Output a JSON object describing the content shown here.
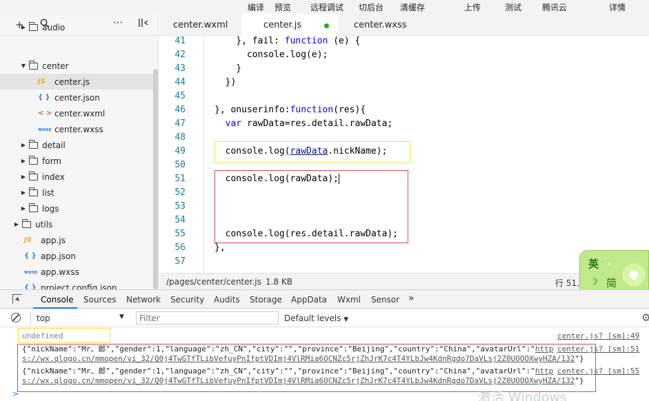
{
  "toolbar": {
    "items": [
      "编译",
      "预览",
      "远程调试",
      "切后台",
      "清缓存",
      "上传",
      "测试",
      "腾讯云",
      "详情"
    ]
  },
  "sidebar": {
    "tree": [
      {
        "label": "audio",
        "kind": "folder",
        "expanded": false
      },
      {
        "label": "center",
        "kind": "folder",
        "expanded": true
      },
      {
        "label": "center.js",
        "kind": "file",
        "icon": "JS",
        "selected": true
      },
      {
        "label": "center.json",
        "kind": "file",
        "icon": "{ }"
      },
      {
        "label": "center.wxml",
        "kind": "file",
        "icon": "< >"
      },
      {
        "label": "center.wxss",
        "kind": "file",
        "icon": "wxss"
      },
      {
        "label": "detail",
        "kind": "folder",
        "expanded": false
      },
      {
        "label": "form",
        "kind": "folder",
        "expanded": false
      },
      {
        "label": "index",
        "kind": "folder",
        "expanded": false
      },
      {
        "label": "list",
        "kind": "folder",
        "expanded": false
      },
      {
        "label": "logs",
        "kind": "folder",
        "expanded": false
      },
      {
        "label": "utils",
        "kind": "folder",
        "expanded": false
      },
      {
        "label": "app.js",
        "kind": "file",
        "icon": "JS"
      },
      {
        "label": "app.json",
        "kind": "file",
        "icon": "{ }"
      },
      {
        "label": "app.wxss",
        "kind": "file",
        "icon": "wxss"
      },
      {
        "label": "project.config.json",
        "kind": "file",
        "icon": "{ }"
      }
    ]
  },
  "tabs": [
    {
      "label": "center.wxml",
      "active": false
    },
    {
      "label": "center.js",
      "active": true,
      "modified": true
    },
    {
      "label": "center.wxss",
      "active": false
    }
  ],
  "editor": {
    "lines": [
      {
        "n": "41",
        "t": "    }, fail: function (e) {"
      },
      {
        "n": "42",
        "t": "      console.log(e);"
      },
      {
        "n": "43",
        "t": "    }"
      },
      {
        "n": "44",
        "t": "  })"
      },
      {
        "n": "45",
        "t": ""
      },
      {
        "n": "46",
        "t": "}, onuserinfo:function(res){"
      },
      {
        "n": "47",
        "t": "  var rawData=res.detail.rawData;"
      },
      {
        "n": "48",
        "t": ""
      },
      {
        "n": "49",
        "t": "  console.log(rawData.nickName);"
      },
      {
        "n": "50",
        "t": ""
      },
      {
        "n": "51",
        "t": "  console.log(rawData);"
      },
      {
        "n": "52",
        "t": ""
      },
      {
        "n": "53",
        "t": ""
      },
      {
        "n": "54",
        "t": ""
      },
      {
        "n": "55",
        "t": "  console.log(res.detail.rawData);"
      },
      {
        "n": "56",
        "t": "},"
      },
      {
        "n": "57",
        "t": ""
      }
    ]
  },
  "status": {
    "path": "/pages/center/center.js",
    "size": "1.8 KB",
    "position": "行 51,"
  },
  "ime": {
    "lang": "英",
    "punct": "’,",
    "mode_icon": "☽",
    "script": "简"
  },
  "devtools": {
    "tabs": [
      "Console",
      "Sources",
      "Network",
      "Security",
      "Audits",
      "Storage",
      "AppData",
      "Wxml",
      "Sensor"
    ],
    "more": "»",
    "context": "top",
    "filter_placeholder": "Filter",
    "levels": "Default levels"
  },
  "console": {
    "entries": [
      {
        "text": "undefined",
        "source": "center.js? [sm]:49"
      },
      {
        "text_1": "{\"nickName\":\"Mr、郎\",\"gender\":1,\"language\":\"zh_CN\",\"city\":\"\",\"province\":\"Beijing\",\"country\":\"China\",\"avatarUrl\":\"",
        "link_1": "http",
        "link_2": "s://wx.qlogo.cn/mmopen/vi_32/Q0j4TwGTfTLibVefuyPnIfptVDImj4VlRMia6OCNZc5rjZhJrK7c4T4YLbJw4KdnRgdo7DaVLsj2Z0UOOOXwyHZA/132",
        "text_2": "\"}",
        "source": "center.js? [sm]:51"
      },
      {
        "text_1": "{\"nickName\":\"Mr、郎\",\"gender\":1,\"language\":\"zh_CN\",\"city\":\"\",\"province\":\"Beijing\",\"country\":\"China\",\"avatarUrl\":\"",
        "link_1": "http",
        "link_2": "s://wx.qlogo.cn/mmopen/vi_32/Q0j4TwGTfTLibVefuyPnIfptVDImj4VlRMia6OCNZc5rjZhJrK7c4T4YLbJw4KdnRgdo7DaVLsj2Z0UOOOXwyHZA/132",
        "text_2": "\"}",
        "source": "center.js? [sm]:55"
      }
    ],
    "prompt": ">"
  },
  "watermark": "激活 Windows",
  "colors": {
    "highlight_yellow": "#f5e52b",
    "highlight_red": "#d94a4a",
    "modified_dot": "#1aad19",
    "active_tab_underline": "#1a73e8"
  }
}
